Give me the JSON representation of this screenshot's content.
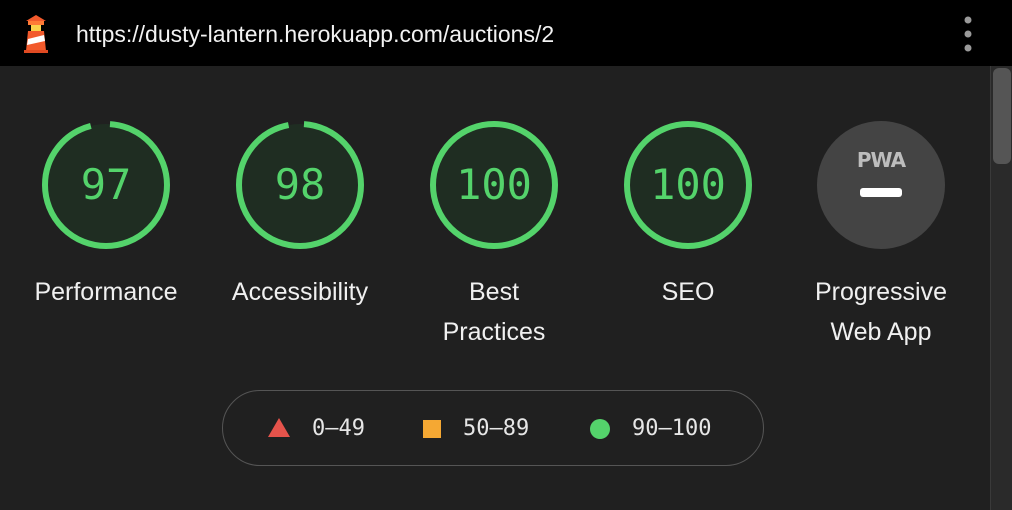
{
  "address_bar": {
    "url": "https://dusty-lantern.herokuapp.com/auctions/2",
    "logo_icon": "lighthouse-icon",
    "menu_icon": "kebab-menu-icon"
  },
  "categories": [
    {
      "label": "Performance",
      "score": "97",
      "value": 97,
      "color": "#54d36b"
    },
    {
      "label": "Accessibility",
      "score": "98",
      "value": 98,
      "color": "#54d36b"
    },
    {
      "label": "Best Practices",
      "score": "100",
      "value": 100,
      "color": "#54d36b"
    },
    {
      "label": "SEO",
      "score": "100",
      "value": 100,
      "color": "#54d36b"
    }
  ],
  "pwa": {
    "badge": "PWA",
    "label": "Progressive Web App"
  },
  "legend": {
    "items": [
      {
        "range": "0–49",
        "shape": "triangle",
        "color": "#e5534b"
      },
      {
        "range": "50–89",
        "shape": "square",
        "color": "#f5a833"
      },
      {
        "range": "90–100",
        "shape": "circle",
        "color": "#54d36b"
      }
    ]
  }
}
